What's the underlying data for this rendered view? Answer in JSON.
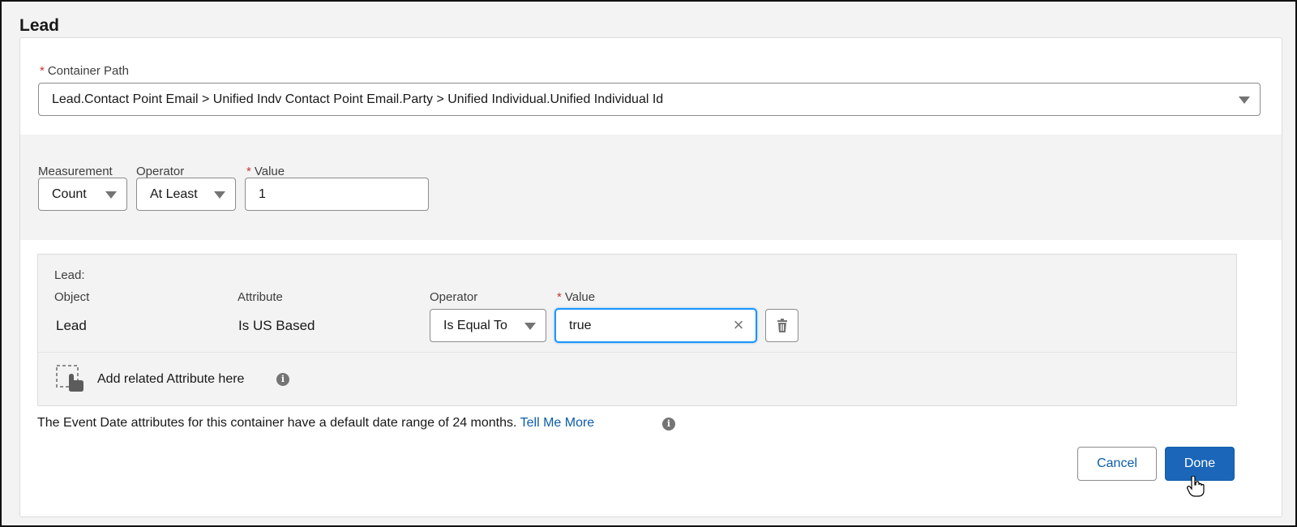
{
  "section": {
    "title": "Lead"
  },
  "container_path": {
    "label": "Container Path",
    "required_mark": "*",
    "value": "Lead.Contact Point Email > Unified Indv Contact Point Email.Party > Unified Individual.Unified Individual Id"
  },
  "measurement": {
    "measurement_label": "Measurement",
    "measurement_value": "Count",
    "operator_label": "Operator",
    "operator_value": "At Least",
    "value_label": "Value",
    "value_required_mark": "*",
    "value_value": "1"
  },
  "attribute_panel": {
    "heading": "Lead:",
    "object_label": "Object",
    "object_value": "Lead",
    "attribute_label": "Attribute",
    "attribute_value": "Is US Based",
    "operator_label": "Operator",
    "operator_value": "Is Equal To",
    "value_label": "Value",
    "value_required_mark": "*",
    "value_value": "true",
    "add_related_text": "Add related Attribute here"
  },
  "note": {
    "text": "The Event Date attributes for this container have a default date range of 24 months.",
    "link": "Tell Me More"
  },
  "buttons": {
    "cancel": "Cancel",
    "done": "Done"
  },
  "colors": {
    "brand": "#1b66b8",
    "link": "#0b5cab",
    "required": "#c23934",
    "focus": "#1b96ff"
  },
  "icons": [
    "chevron-down-icon",
    "close-icon",
    "trash-icon",
    "drag-drop-icon",
    "info-icon",
    "hand-cursor-icon"
  ]
}
